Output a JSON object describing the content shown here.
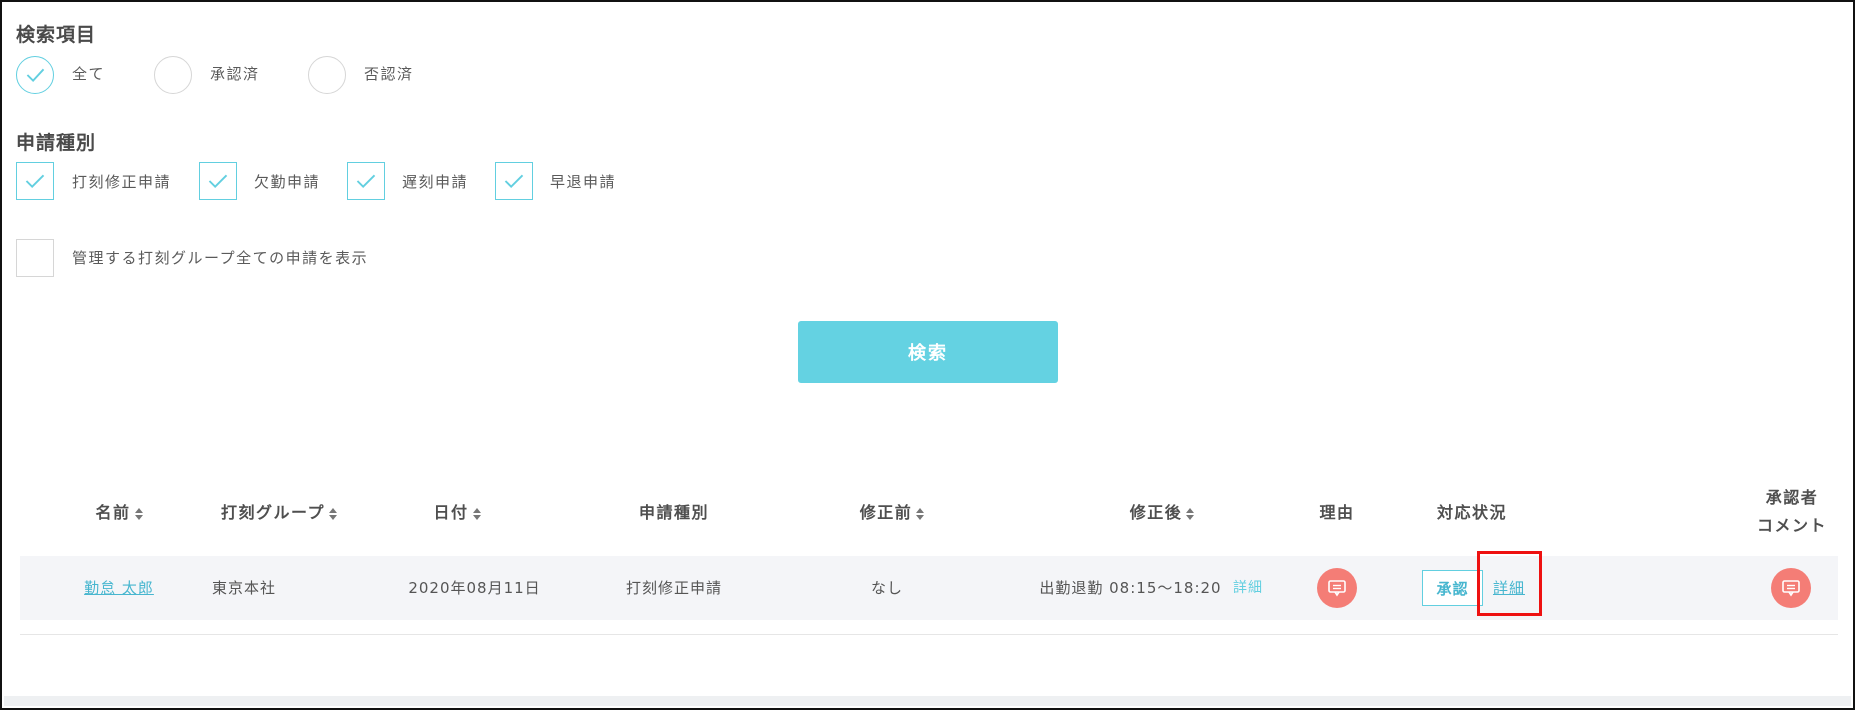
{
  "search_items": {
    "title": "検索項目",
    "options": [
      {
        "label": "全て",
        "checked": true
      },
      {
        "label": "承認済",
        "checked": false
      },
      {
        "label": "否認済",
        "checked": false
      }
    ]
  },
  "request_types": {
    "title": "申請種別",
    "options": [
      {
        "label": "打刻修正申請",
        "checked": true
      },
      {
        "label": "欠勤申請",
        "checked": true
      },
      {
        "label": "遅刻申請",
        "checked": true
      },
      {
        "label": "早退申請",
        "checked": true
      }
    ]
  },
  "show_all_groups": {
    "label": "管理する打刻グループ全ての申請を表示",
    "checked": false
  },
  "search_button": "検索",
  "table": {
    "headers": {
      "name": "名前",
      "group": "打刻グループ",
      "date": "日付",
      "type": "申請種別",
      "before": "修正前",
      "after": "修正後",
      "reason": "理由",
      "status": "対応状況",
      "approver_comment_line1": "承認者",
      "approver_comment_line2": "コメント"
    },
    "rows": [
      {
        "name": "勤怠 太郎",
        "group": "東京本社",
        "date": "2020年08月11日",
        "type": "打刻修正申請",
        "before": "なし",
        "after": "出勤退勤 08:15〜18:20",
        "after_detail": "詳細",
        "approve": "承認",
        "status_detail": "詳細"
      }
    ]
  },
  "colors": {
    "accent": "#64d2e2",
    "comment": "#f47d76",
    "highlight": "#ee1111"
  }
}
